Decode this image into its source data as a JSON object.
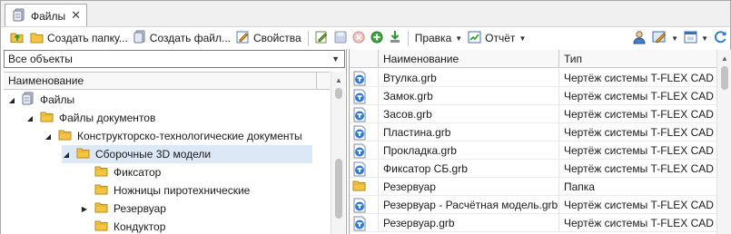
{
  "tab": {
    "label": "Файлы",
    "close": "✕"
  },
  "toolbar": {
    "create_folder": "Создать папку...",
    "create_file": "Создать файл...",
    "properties": "Свойства",
    "edit_menu": "Правка",
    "report_menu": "Отчёт"
  },
  "filter": {
    "value": "Все объекты"
  },
  "left_header": {
    "name": "Наименование"
  },
  "tree": [
    {
      "label": "Файлы",
      "expanded": true,
      "icon": "files-root-icon"
    },
    {
      "label": "Файлы документов",
      "expanded": true,
      "icon": "folder-icon"
    },
    {
      "label": "Конструкторско-технологические документы",
      "expanded": true,
      "icon": "folder-icon"
    },
    {
      "label": "Сборочные 3D модели",
      "expanded": true,
      "selected": true,
      "icon": "folder-icon"
    },
    {
      "label": "Фиксатор",
      "icon": "folder-icon"
    },
    {
      "label": "Ножницы пиротехнические",
      "icon": "folder-icon"
    },
    {
      "label": "Резервуар",
      "collapsed": true,
      "icon": "folder-icon"
    },
    {
      "label": "Кондуктор",
      "icon": "folder-icon"
    }
  ],
  "right_header": {
    "name": "Наименование",
    "type": "Тип"
  },
  "files": [
    {
      "name": "Втулка.grb",
      "type": "Чертёж системы T-FLEX CAD",
      "icon": "tflex-drawing-icon"
    },
    {
      "name": "Замок.grb",
      "type": "Чертёж системы T-FLEX CAD",
      "icon": "tflex-drawing-icon"
    },
    {
      "name": "Засов.grb",
      "type": "Чертёж системы T-FLEX CAD",
      "icon": "tflex-drawing-icon"
    },
    {
      "name": "Пластина.grb",
      "type": "Чертёж системы T-FLEX CAD",
      "icon": "tflex-drawing-icon"
    },
    {
      "name": "Прокладка.grb",
      "type": "Чертёж системы T-FLEX CAD",
      "icon": "tflex-drawing-icon"
    },
    {
      "name": "Фиксатор СБ.grb",
      "type": "Чертёж системы T-FLEX CAD",
      "icon": "tflex-drawing-icon"
    },
    {
      "name": "Резервуар",
      "type": "Папка",
      "icon": "folder-icon"
    },
    {
      "name": "Резервуар - Расчётная модель.grb",
      "type": "Чертёж системы T-FLEX CAD",
      "icon": "tflex-drawing-icon"
    },
    {
      "name": "Резервуар.grb",
      "type": "Чертёж системы T-FLEX CAD",
      "icon": "tflex-drawing-icon"
    }
  ],
  "colors": {
    "selection": "#dde8f7",
    "folder": "#f5c542",
    "tflex_blue": "#2f7bd3"
  }
}
